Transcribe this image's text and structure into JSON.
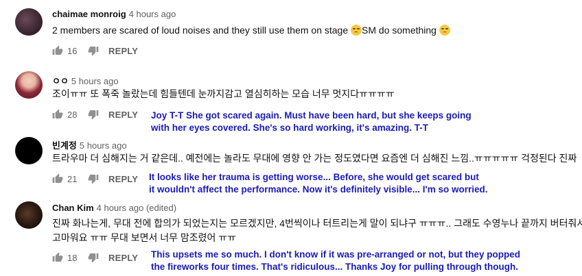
{
  "comments": [
    {
      "author": "chaimae monroig",
      "time": "4 hours ago",
      "text": "2 members are scared of loud noises and they still use them on stage",
      "text_after_emoji": "SM do something",
      "emoji_1": "pensive-face-emoji",
      "emoji_2": "frowning-face-emoji",
      "likes": "16",
      "reply_label": "REPLY"
    },
    {
      "author": "ㅇㅇ",
      "time": "5 hours ago",
      "text": "조이ㅠㅠ 또 폭죽 놀랐는데 힘들텐데 눈까지감고 열심히하는 모습 너무 멋지다ㅠㅠㅠㅠ",
      "likes": "28",
      "reply_label": "REPLY",
      "translation_line1": "Joy T-T She got scared again. Must have been hard, but she keeps going",
      "translation_line2": "with her eyes covered. She's so hard working, it's amazing. T-T"
    },
    {
      "author": "빈계정",
      "time": "5 hours ago",
      "text": "트라우마 더 심해지는 거 같은데.. 예전에는 놀라도 무대에 영향 안 가는 정도였다면 요즘엔 더 심해진 느낌..ㅠㅠㅠㅠㅠ 걱정된다 진짜",
      "likes": "21",
      "reply_label": "REPLY",
      "translation_line1": "It looks like her trauma is getting worse... Before, she would get scared but",
      "translation_line2": "it wouldn't affect the performance. Now it's definitely visible... I'm so worried."
    },
    {
      "author": "Chan Kim",
      "time": "4 hours ago (edited)",
      "text_line1": "진짜 화나는게, 무대 전에 합의가 되었는지는 모르겠지만, 4번씩이나 터트리는게 말이 되냐구 ㅠㅠㅠ.. 그래도 수영누나 끝까지 버터줘서 정말",
      "text_line2": "고마워요 ㅠㅠ 무대 보면서 너무 맘조렸어 ㅠㅠ",
      "likes": "18",
      "reply_label": "REPLY",
      "translation_line1": "This upsets me so much. I don't know if it was pre-arranged or not, but they popped",
      "translation_line2": "the fireworks four times. That's ridiculous... Thanks Joy for pulling through though."
    }
  ]
}
